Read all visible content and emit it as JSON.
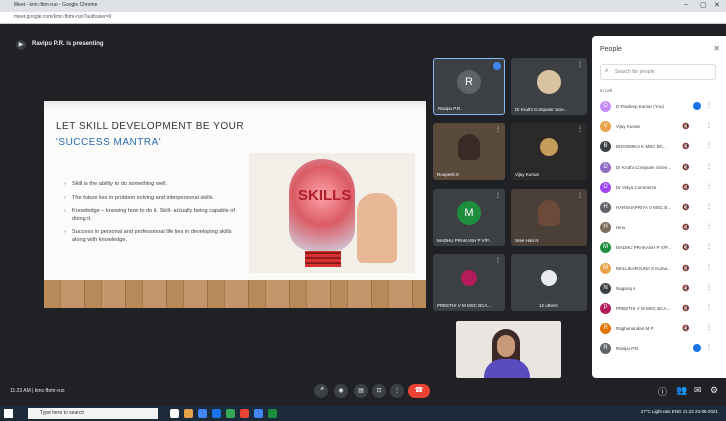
{
  "browser": {
    "title": "Meet - kmc-fbm-ruo - Google Chrome",
    "url": "meet.google.com/kmc-fbmr-ruo?authuser=0"
  },
  "meeting": {
    "presenting_label": "Ravipu P.R. is presenting",
    "clock_label": "11:23 AM | kmc-fbmr-ruo"
  },
  "slide": {
    "heading_line1": "LET SKILL DEVELOPMENT BE YOUR",
    "heading_line2": "'SUCCESS MANTRA'",
    "bullets": [
      "Skill is the ability to do something well.",
      "The future lies in problem solving and interpersonal skills.",
      "Knowledge – knowing how to do it. Skill- actually being capable of doing it.",
      "Success in personal and professional life lies in developing skills along with knowledge."
    ],
    "image_word": "SKILLS"
  },
  "tiles": [
    {
      "name": "Ravipu P.R.",
      "initial": "R",
      "color": "#5f6368"
    },
    {
      "name": "Dr Kruthi Computer Scie...",
      "initial": "",
      "color": "#d8c2a0"
    },
    {
      "name": "Roopesh K",
      "initial": "",
      "color": "#8a6b4c"
    },
    {
      "name": "Vijay Kumar",
      "initial": "",
      "color": "#c79b5a"
    },
    {
      "name": "MADHU PRAKASH P V/P...",
      "initial": "M",
      "color": "#1e8e3e"
    },
    {
      "name": "Sree Hari N",
      "initial": "",
      "color": "#6b4a3a"
    },
    {
      "name": "PREETHI V M MSC BCA...",
      "initial": "",
      "color": "#b31b5a"
    },
    {
      "name": "12 others",
      "initial": "",
      "color": "#e8eaed"
    }
  ],
  "people_panel": {
    "title": "People",
    "search_placeholder": "Search for people",
    "section_label": "In call",
    "people": [
      {
        "name": "D Pradeep Kumar (You)",
        "initial": "D",
        "color": "#c58af9"
      },
      {
        "name": "Vijay Kumar",
        "initial": "V",
        "color": "#e8a24a"
      },
      {
        "name": "BHOOMIKA K MSC BC...",
        "initial": "B",
        "color": "#3c4043"
      },
      {
        "name": "Dr Kruthi Computer Scien...",
        "initial": "D",
        "color": "#8e6cc4"
      },
      {
        "name": "Dr Vidya Commerce",
        "initial": "D",
        "color": "#a142f4"
      },
      {
        "name": "HARSHAPRIYA V MSC B...",
        "initial": "H",
        "color": "#5f6368"
      },
      {
        "name": "Hinu",
        "initial": "H",
        "color": "#7b6b5a"
      },
      {
        "name": "MADHU PRAKASH P V/P...",
        "initial": "M",
        "color": "#1e8e3e"
      },
      {
        "name": "MALLIKARJUNA S Kuma...",
        "initial": "M",
        "color": "#e8a24a"
      },
      {
        "name": "Nagaraj s",
        "initial": "N",
        "color": "#3c4043"
      },
      {
        "name": "PREETHI V M MSC BCA...",
        "initial": "P",
        "color": "#b31b5a"
      },
      {
        "name": "Raghunandan M P",
        "initial": "R",
        "color": "#e37400"
      },
      {
        "name": "Ravipu P.R.",
        "initial": "R",
        "color": "#5f6368"
      }
    ]
  },
  "taskbar": {
    "search_placeholder": "Type here to search",
    "tray_text": "27°C Light rain  ENG  11:23  23-08-2021"
  }
}
